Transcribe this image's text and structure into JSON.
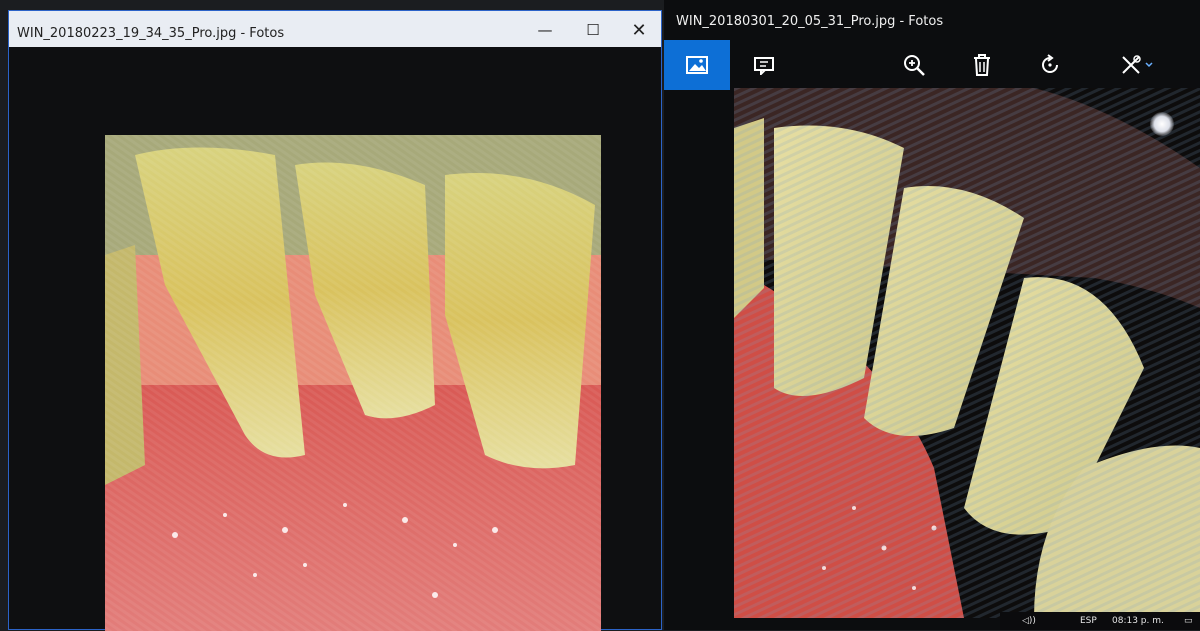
{
  "left_window": {
    "title": "WIN_20180223_19_34_35_Pro.jpg - Fotos",
    "controls": {
      "minimize": "—",
      "maximize": "☐",
      "close": "✕"
    },
    "image": {
      "subject": "dental-photo-lower-teeth",
      "icon": "photo-image"
    }
  },
  "right_window": {
    "title": "WIN_20180301_20_05_31_Pro.jpg - Fotos",
    "toolbar": [
      {
        "icon": "image-view-icon",
        "active": true
      },
      {
        "icon": "slideshow-icon",
        "active": false
      },
      {
        "icon": "zoom-in-icon",
        "active": false
      },
      {
        "icon": "delete-icon",
        "active": false
      },
      {
        "icon": "rotate-icon",
        "active": false
      },
      {
        "icon": "edit-icon",
        "active": false
      }
    ],
    "accent_color": "#0d6fd6",
    "image": {
      "subject": "dental-photo-lower-teeth-closeup"
    }
  },
  "taskbar": {
    "language": "ESP",
    "time": "08:13 p. m."
  }
}
